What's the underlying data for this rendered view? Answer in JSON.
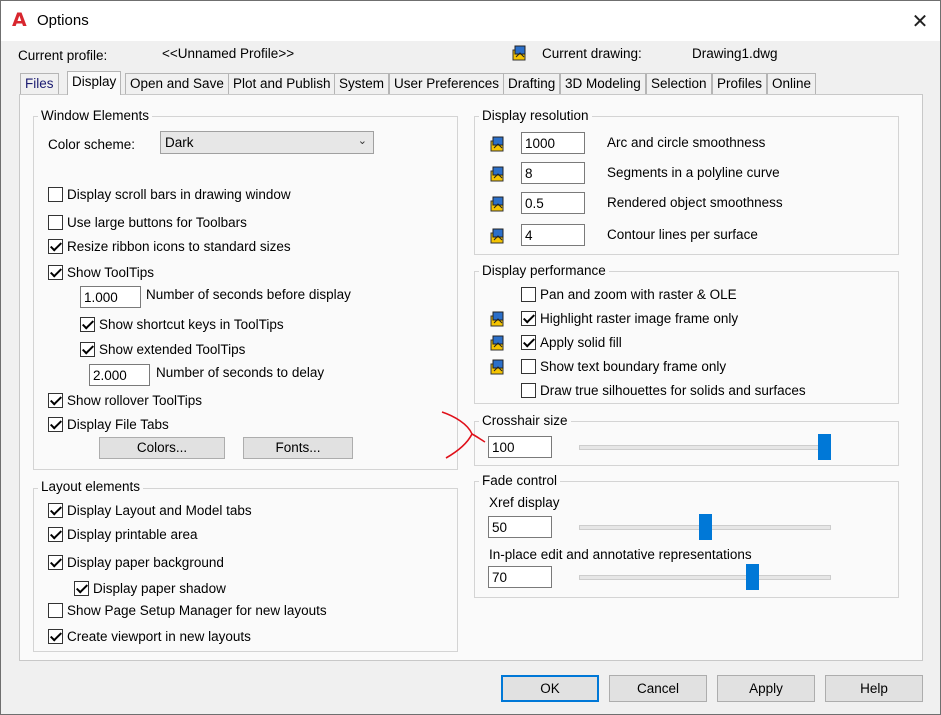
{
  "window": {
    "title": "Options",
    "close_glyph": "✕",
    "logo_glyph": "A"
  },
  "header": {
    "current_profile_label": "Current profile:",
    "current_profile_value": "<<Unnamed Profile>>",
    "current_drawing_label": "Current drawing:",
    "current_drawing_value": "Drawing1.dwg"
  },
  "tabs": [
    "Files",
    "Display",
    "Open and Save",
    "Plot and Publish",
    "System",
    "User Preferences",
    "Drafting",
    "3D Modeling",
    "Selection",
    "Profiles",
    "Online"
  ],
  "active_tab": "Display",
  "window_elements": {
    "title": "Window Elements",
    "color_scheme_label": "Color scheme:",
    "color_scheme_value": "Dark",
    "display_scroll_bars": {
      "label": "Display scroll bars in drawing window",
      "checked": false
    },
    "use_large_buttons": {
      "label": "Use large buttons for Toolbars",
      "checked": false
    },
    "resize_ribbon_icons": {
      "label": "Resize ribbon icons to standard sizes",
      "checked": true
    },
    "show_tooltips": {
      "label": "Show ToolTips",
      "checked": true
    },
    "seconds_before_display_value": "1.000",
    "seconds_before_display_label": "Number of seconds before display",
    "show_shortcut_keys": {
      "label": "Show shortcut keys in ToolTips",
      "checked": true
    },
    "show_extended_tooltips": {
      "label": "Show extended ToolTips",
      "checked": true
    },
    "seconds_to_delay_value": "2.000",
    "seconds_to_delay_label": "Number of seconds to delay",
    "show_rollover_tooltips": {
      "label": "Show rollover ToolTips",
      "checked": true
    },
    "display_file_tabs": {
      "label": "Display File Tabs",
      "checked": true
    },
    "colors_button": "Colors...",
    "fonts_button": "Fonts..."
  },
  "layout_elements": {
    "title": "Layout elements",
    "items": [
      {
        "label": "Display Layout and Model tabs",
        "checked": true
      },
      {
        "label": "Display printable area",
        "checked": true
      },
      {
        "label": "Display paper background",
        "checked": true
      },
      {
        "label": "Display paper shadow",
        "checked": true
      },
      {
        "label": "Show Page Setup Manager for new layouts",
        "checked": false
      },
      {
        "label": "Create viewport in new layouts",
        "checked": true
      }
    ]
  },
  "display_resolution": {
    "title": "Display resolution",
    "items": [
      {
        "value": "1000",
        "label": "Arc and circle smoothness"
      },
      {
        "value": "8",
        "label": "Segments in a polyline curve"
      },
      {
        "value": "0.5",
        "label": "Rendered object smoothness"
      },
      {
        "value": "4",
        "label": "Contour lines per surface"
      }
    ]
  },
  "display_performance": {
    "title": "Display performance",
    "items": [
      {
        "label": "Pan and zoom with raster & OLE",
        "checked": false,
        "has_icon": false
      },
      {
        "label": "Highlight raster image frame only",
        "checked": true,
        "has_icon": true
      },
      {
        "label": "Apply solid fill",
        "checked": true,
        "has_icon": true
      },
      {
        "label": "Show text boundary frame only",
        "checked": false,
        "has_icon": true
      },
      {
        "label": "Draw true silhouettes for solids and surfaces",
        "checked": false,
        "has_icon": false
      }
    ]
  },
  "crosshair": {
    "title": "Crosshair size",
    "value": "100",
    "slider_fraction": 1.0
  },
  "fade_control": {
    "title": "Fade control",
    "xref_label": "Xref display",
    "xref_value": "50",
    "xref_fraction": 0.5,
    "inplace_label": "In-place edit and annotative representations",
    "inplace_value": "70",
    "inplace_fraction": 0.7
  },
  "buttons": {
    "ok": "OK",
    "cancel": "Cancel",
    "apply": "Apply",
    "help": "Help"
  },
  "colors": {
    "accent": "#0078d7",
    "logo_red": "#d8262e",
    "annotation_red": "#e0101a"
  }
}
